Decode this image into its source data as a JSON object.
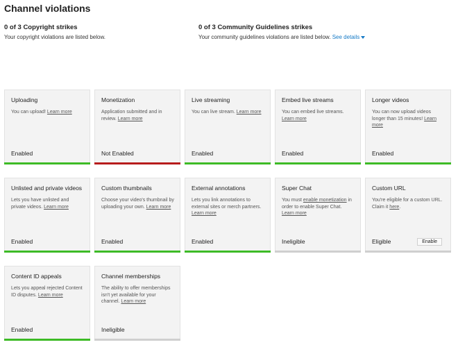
{
  "page": {
    "title": "Channel violations"
  },
  "copyright": {
    "heading": "0 of 3 Copyright strikes",
    "text": "Your copyright violations are listed below."
  },
  "community": {
    "heading": "0 of 3 Community Guidelines strikes",
    "text": "Your community guidelines violations are listed below.",
    "see_details": "See details"
  },
  "colors": {
    "enabled": "#3dbb26",
    "not_enabled": "#b71c1c",
    "neutral": "#cfcfcf"
  },
  "features": [
    {
      "title": "Uploading",
      "desc": "You can upload!",
      "link": "Learn more",
      "status": "Enabled",
      "state": "enabled"
    },
    {
      "title": "Monetization",
      "desc": "Application submitted and in review.",
      "link": "Learn more",
      "status": "Not Enabled",
      "state": "not_enabled"
    },
    {
      "title": "Live streaming",
      "desc": "You can live stream.",
      "link": "Learn more",
      "status": "Enabled",
      "state": "enabled"
    },
    {
      "title": "Embed live streams",
      "desc": "You can embed live streams.",
      "link": "Learn more",
      "status": "Enabled",
      "state": "enabled"
    },
    {
      "title": "Longer videos",
      "desc": "You can now upload videos longer than 15 minutes!",
      "link": "Learn more",
      "status": "Enabled",
      "state": "enabled"
    },
    {
      "title": "Unlisted and private videos",
      "desc": "Lets you have unlisted and private videos.",
      "link": "Learn more",
      "status": "Enabled",
      "state": "enabled"
    },
    {
      "title": "Custom thumbnails",
      "desc": "Choose your video's thumbnail by uploading your own.",
      "link": "Learn more",
      "status": "Enabled",
      "state": "enabled"
    },
    {
      "title": "External annotations",
      "desc": "Lets you link annotations to external sites or merch partners.",
      "link": "Learn more",
      "status": "Enabled",
      "state": "enabled"
    },
    {
      "title": "Super Chat",
      "desc_pre": "You must",
      "desc_link": "enable monetization",
      "desc": "in order to enable Super Chat.",
      "link": "Learn more",
      "status": "Ineligible",
      "state": "neutral"
    },
    {
      "title": "Custom URL",
      "desc": "You're eligible for a custom URL. Claim it",
      "link": "here",
      "desc_post": ".",
      "status": "Eligible",
      "state": "neutral",
      "button": "Enable"
    },
    {
      "title": "Content ID appeals",
      "desc": "Lets you appeal rejected Content ID disputes.",
      "link": "Learn more",
      "status": "Enabled",
      "state": "enabled"
    },
    {
      "title": "Channel memberships",
      "desc": "The ability to offer memberships isn't yet available for your channel.",
      "link": "Learn more",
      "status": "Ineligible",
      "state": "neutral"
    }
  ]
}
